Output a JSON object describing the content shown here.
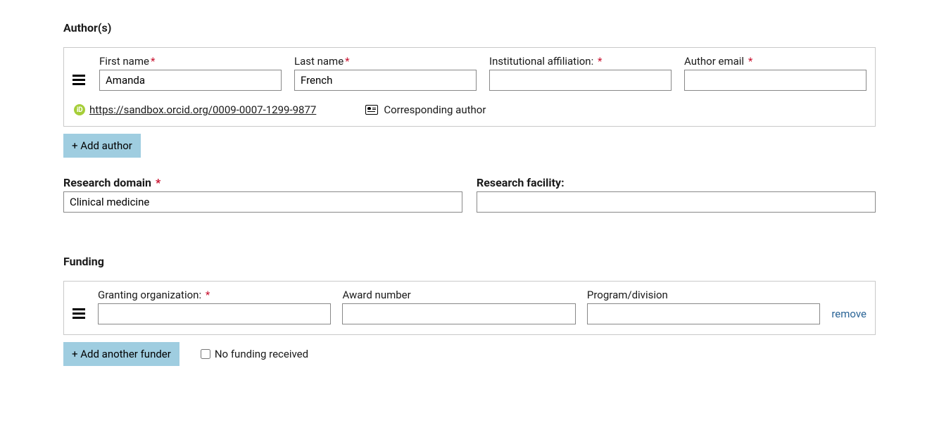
{
  "authors": {
    "heading": "Author(s)",
    "entries": [
      {
        "first_name_label": "First name",
        "last_name_label": "Last name",
        "affiliation_label": "Institutional affiliation:",
        "email_label": "Author email",
        "first_name": "Amanda",
        "last_name": "French",
        "affiliation": "",
        "email": "",
        "orcid_url": "https://sandbox.orcid.org/0009-0007-1299-9877",
        "corresponding_label": "Corresponding author"
      }
    ],
    "add_button": "+ Add author"
  },
  "research": {
    "domain_label": "Research domain",
    "domain_value": "Clinical medicine",
    "facility_label": "Research facility:",
    "facility_value": ""
  },
  "funding": {
    "heading": "Funding",
    "entries": [
      {
        "org_label": "Granting organization:",
        "award_label": "Award number",
        "program_label": "Program/division",
        "org_value": "",
        "award_value": "",
        "program_value": ""
      }
    ],
    "remove_label": "remove",
    "add_button": "+ Add another funder",
    "no_funding_label": "No funding received"
  }
}
